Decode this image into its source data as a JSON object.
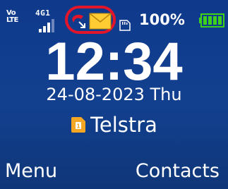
{
  "status_bar": {
    "volte_line1": "Vo",
    "volte_line2": "LTE",
    "network_type": "4G1",
    "signal_bars": 3,
    "missed_call_icon": "missed-call-icon",
    "message_icon": "envelope-icon",
    "storage_icon": "sd-card-icon",
    "battery_percent": "100%",
    "battery_level": 1.0,
    "highlight_color": "#e3152a"
  },
  "home": {
    "time": "12:34",
    "date": "24-08-2023 Thu",
    "sim_slot": "1",
    "operator": "Telstra"
  },
  "softkeys": {
    "left_label": "Menu",
    "right_label": "Contacts"
  },
  "colors": {
    "background": "#12408f",
    "battery_fill": "#3fd11a",
    "sim_icon": "#f5a623",
    "envelope": "#ffcc33"
  }
}
